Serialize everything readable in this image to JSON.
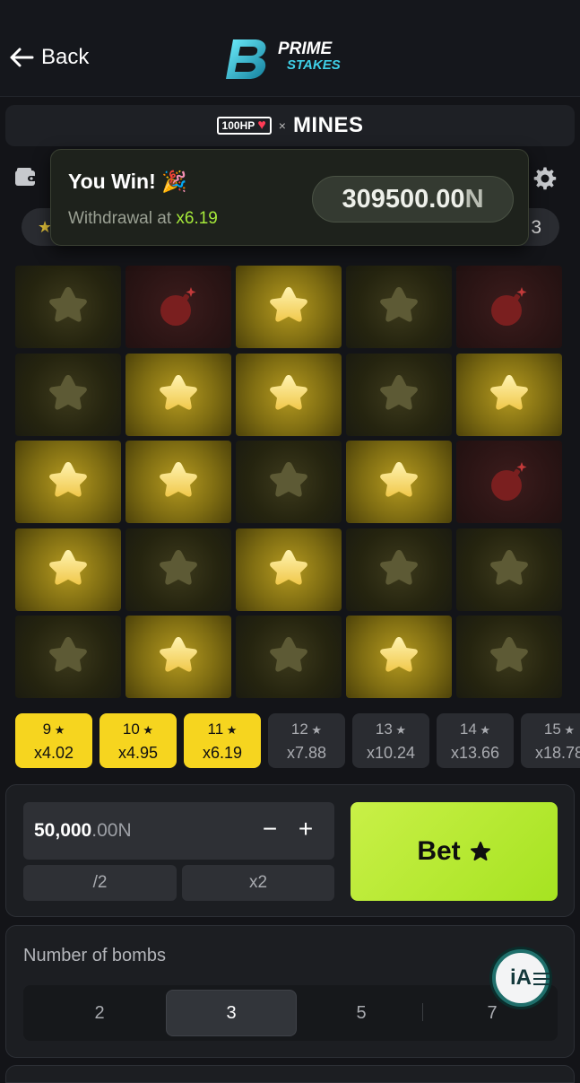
{
  "header": {
    "back_label": "Back",
    "logo_line1": "PRIME",
    "logo_line2": "STAKES",
    "logo_mark": "PS"
  },
  "game_bar": {
    "badge_text": "100HP",
    "separator": "×",
    "title": "MINES"
  },
  "toast": {
    "title": "You Win! 🎉",
    "withdraw_prefix": "Withdrawal at ",
    "withdraw_multiplier": "x6.19",
    "amount_value": "309500.00",
    "amount_currency": "N"
  },
  "stats": {
    "right_value": "3"
  },
  "grid": {
    "rows": 5,
    "cols": 5,
    "tiles": [
      "star-dim",
      "bomb",
      "star-lit",
      "star-dim",
      "bomb",
      "star-dim",
      "star-lit",
      "star-lit",
      "star-dim",
      "star-lit",
      "star-lit",
      "star-lit",
      "star-dim",
      "star-lit",
      "bomb",
      "star-lit",
      "star-dim",
      "star-lit",
      "star-dim",
      "star-dim",
      "star-dim",
      "star-lit",
      "star-dim",
      "star-lit",
      "star-dim"
    ]
  },
  "multipliers": [
    {
      "count": "9",
      "mult": "x4.02",
      "active": true
    },
    {
      "count": "10",
      "mult": "x4.95",
      "active": true
    },
    {
      "count": "11",
      "mult": "x6.19",
      "active": true
    },
    {
      "count": "12",
      "mult": "x7.88",
      "active": false
    },
    {
      "count": "13",
      "mult": "x10.24",
      "active": false
    },
    {
      "count": "14",
      "mult": "x13.66",
      "active": false
    },
    {
      "count": "15",
      "mult": "x18.78",
      "active": false
    }
  ],
  "bet": {
    "amount_int": "50,000",
    "amount_dec": ".00",
    "amount_currency": "N",
    "minus": "−",
    "plus": "+",
    "half_label": "/2",
    "double_label": "x2",
    "bet_label": "Bet"
  },
  "bombs": {
    "label": "Number of bombs",
    "options": [
      "2",
      "3",
      "5",
      "7"
    ],
    "selected": "3"
  },
  "assistant": {
    "label": "iA"
  },
  "colors": {
    "accent_green": "#a6e321",
    "accent_yellow": "#f6d51f",
    "background": "#131418"
  }
}
